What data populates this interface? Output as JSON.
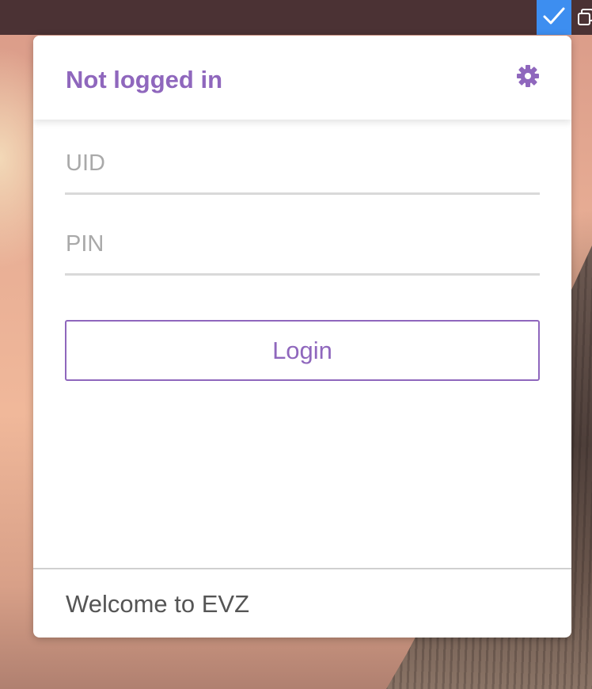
{
  "popover": {
    "title": "Not logged in",
    "settings_icon": "gear-icon",
    "accent_color": "#8f67bd"
  },
  "form": {
    "uid": {
      "placeholder": "UID",
      "value": ""
    },
    "pin": {
      "placeholder": "PIN",
      "value": ""
    },
    "login_label": "Login"
  },
  "footer": {
    "message": "Welcome to EVZ"
  },
  "menubar": {
    "check_icon": "checkmark-icon",
    "windows_icon": "windows-icon",
    "highlight_color": "#3d8ef0",
    "background_color": "#4b3234"
  }
}
